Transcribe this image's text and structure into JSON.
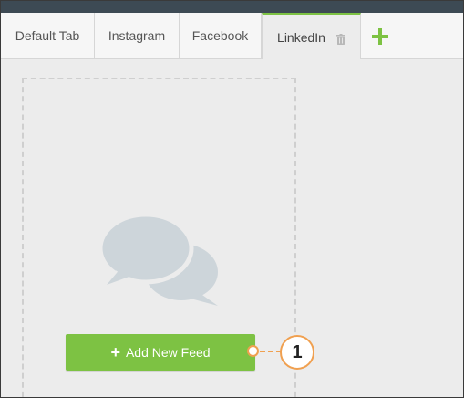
{
  "tabs": [
    {
      "label": "Default Tab"
    },
    {
      "label": "Instagram"
    },
    {
      "label": "Facebook"
    },
    {
      "label": "LinkedIn",
      "active": true
    }
  ],
  "icons": {
    "trash": "trash-icon",
    "add_tab": "plus-icon",
    "feed_placeholder": "chat-bubbles-icon"
  },
  "main": {
    "add_feed_label": "Add New Feed"
  },
  "callout": {
    "number": "1"
  },
  "colors": {
    "accent_green": "#7dc243",
    "callout_orange": "#f0a050",
    "placeholder_icon": "#cdd5da",
    "topbar": "#3d4a54"
  }
}
